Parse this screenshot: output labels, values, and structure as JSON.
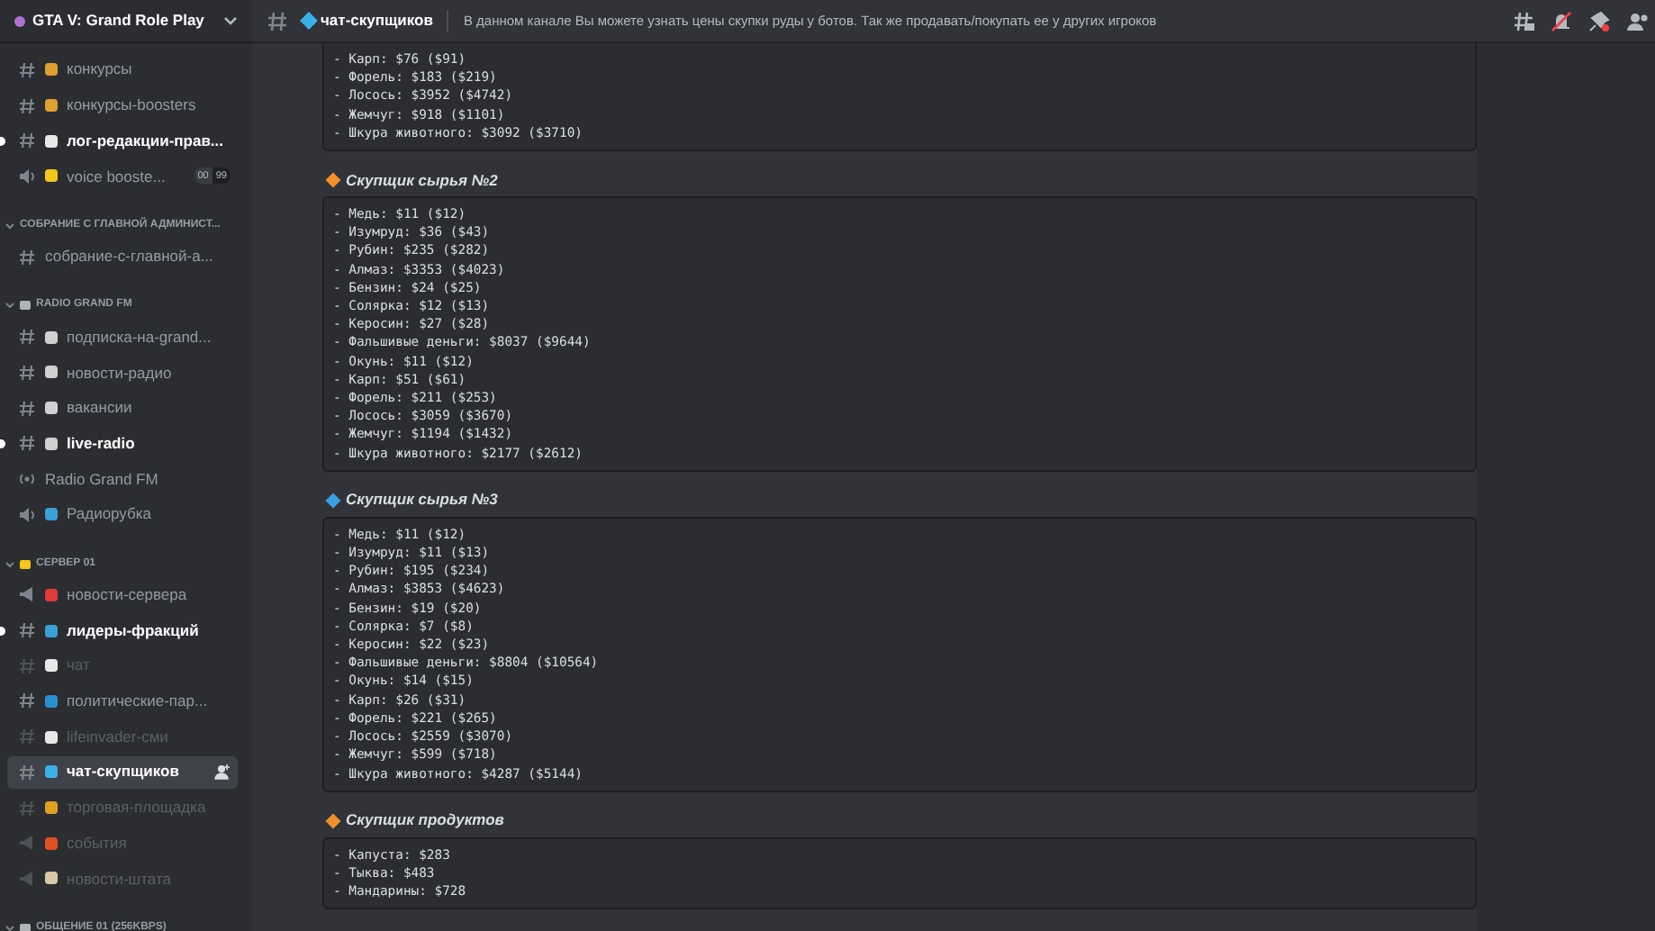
{
  "server": {
    "name": "GTA V: Grand Role Play"
  },
  "sidebar": {
    "sections": [
      {
        "channels": [
          {
            "name": "конкурсы",
            "kind": "text",
            "unread": false,
            "muted": false,
            "selected": false,
            "color": "#e0a030"
          },
          {
            "name": "конкурсы-boosters",
            "kind": "text",
            "unread": false,
            "muted": false,
            "selected": false,
            "color": "#e0a030"
          },
          {
            "name": "лог-редакции-прав...",
            "kind": "text",
            "unread": true,
            "muted": false,
            "selected": false,
            "color": "#e8e8e8"
          },
          {
            "name": "voice booste...",
            "kind": "voice",
            "unread": false,
            "muted": false,
            "selected": false,
            "color": "#f5c518",
            "badges": [
              "00",
              "99"
            ]
          }
        ]
      },
      {
        "name": "СОБРАНИЕ С ГЛАВНОЙ АДМИНИСТ...",
        "channels": [
          {
            "name": "собрание-с-главной-а...",
            "kind": "text",
            "unread": false,
            "muted": false,
            "selected": false
          }
        ]
      },
      {
        "name": "RADIO GRAND FM",
        "color": "#b0b3b8",
        "channels": [
          {
            "name": "подписка-на-grand...",
            "kind": "text",
            "unread": false,
            "muted": false,
            "selected": false,
            "color": "#d0d0d0"
          },
          {
            "name": "новости-радио",
            "kind": "text",
            "unread": false,
            "muted": false,
            "selected": false,
            "color": "#d0d0d0"
          },
          {
            "name": "вакансии",
            "kind": "text",
            "unread": false,
            "muted": false,
            "selected": false,
            "color": "#d0d0d0"
          },
          {
            "name": "live-radio",
            "kind": "text",
            "unread": true,
            "muted": false,
            "selected": false,
            "color": "#d0d0d0"
          },
          {
            "name": "Radio Grand FM",
            "kind": "stage",
            "unread": false,
            "muted": false,
            "selected": false
          },
          {
            "name": "Радиорубка",
            "kind": "voice",
            "unread": false,
            "muted": false,
            "selected": false,
            "color": "#3aa0d8"
          }
        ]
      },
      {
        "name": "СЕРВЕР 01",
        "color": "#f5c518",
        "channels": [
          {
            "name": "новости-сервера",
            "kind": "announcement",
            "unread": false,
            "muted": false,
            "selected": false,
            "color": "#e03a3a"
          },
          {
            "name": "лидеры-фракций",
            "kind": "text",
            "unread": true,
            "muted": false,
            "selected": false,
            "color": "#3aa0d8"
          },
          {
            "name": "чат",
            "kind": "text",
            "unread": false,
            "muted": true,
            "selected": false,
            "color": "#e8e8e8"
          },
          {
            "name": "политические-пар...",
            "kind": "text",
            "unread": false,
            "muted": false,
            "selected": false,
            "color": "#2a8fd0"
          },
          {
            "name": "lifeinvader-сми",
            "kind": "text",
            "unread": false,
            "muted": true,
            "selected": false,
            "color": "#e8e8e8"
          },
          {
            "name": "чат-скупщиков",
            "kind": "text",
            "unread": false,
            "muted": false,
            "selected": true,
            "color": "#3ab0e8"
          },
          {
            "name": "торговая-площадка",
            "kind": "text",
            "unread": false,
            "muted": true,
            "selected": false,
            "color": "#e0a020"
          },
          {
            "name": "события",
            "kind": "announcement",
            "unread": false,
            "muted": true,
            "selected": false,
            "color": "#e05020"
          },
          {
            "name": "новости-штата",
            "kind": "announcement",
            "unread": false,
            "muted": true,
            "selected": false,
            "color": "#d8c8a8"
          }
        ]
      },
      {
        "name": "ОБЩЕНИЕ 01 (256KBPS)",
        "color": "#b0b3b8"
      }
    ]
  },
  "header": {
    "channel": "чат-скупщиков",
    "color": "#3ab0e8",
    "topic": "В данном канале Вы можете узнать цены скупки руды у ботов. Так же продавать/покупать ее у других игроков"
  },
  "blocks": [
    {
      "lines": [
        "- Карп: $76 ($91)",
        "- Форель: $183 ($219)",
        "- Лосось: $3952 ($4742)",
        "- Жемчуг: $918 ($1101)",
        "- Шкура животного: $3092 ($3710)"
      ]
    },
    {
      "title": "Скупщик сырья №2",
      "color": "#f0902a",
      "lines": [
        "- Медь: $11 ($12)",
        "- Изумруд: $36 ($43)",
        "- Рубин: $235 ($282)",
        "- Алмаз: $3353 ($4023)",
        "- Бензин: $24 ($25)",
        "- Солярка: $12 ($13)",
        "- Керосин: $27 ($28)",
        "- Фальшивые деньги: $8037 ($9644)",
        "- Окунь: $11 ($12)",
        "- Карп: $51 ($61)",
        "- Форель: $211 ($253)",
        "- Лосось: $3059 ($3670)",
        "- Жемчуг: $1194 ($1432)",
        "- Шкура животного: $2177 ($2612)"
      ]
    },
    {
      "title": "Скупщик сырья №3",
      "color": "#3a9ee0",
      "lines": [
        "- Медь: $11 ($12)",
        "- Изумруд: $11 ($13)",
        "- Рубин: $195 ($234)",
        "- Алмаз: $3853 ($4623)",
        "- Бензин: $19 ($20)",
        "- Солярка: $7 ($8)",
        "- Керосин: $22 ($23)",
        "- Фальшивые деньги: $8804 ($10564)",
        "- Окунь: $14 ($15)",
        "- Карп: $26 ($31)",
        "- Форель: $221 ($265)",
        "- Лосось: $2559 ($3070)",
        "- Жемчуг: $599 ($718)",
        "- Шкура животного: $4287 ($5144)"
      ]
    },
    {
      "title": "Скупщик продуктов",
      "color": "#f0902a",
      "lines": [
        "- Капуста: $283",
        "- Тыква: $483",
        "- Мандарины: $728"
      ]
    }
  ]
}
